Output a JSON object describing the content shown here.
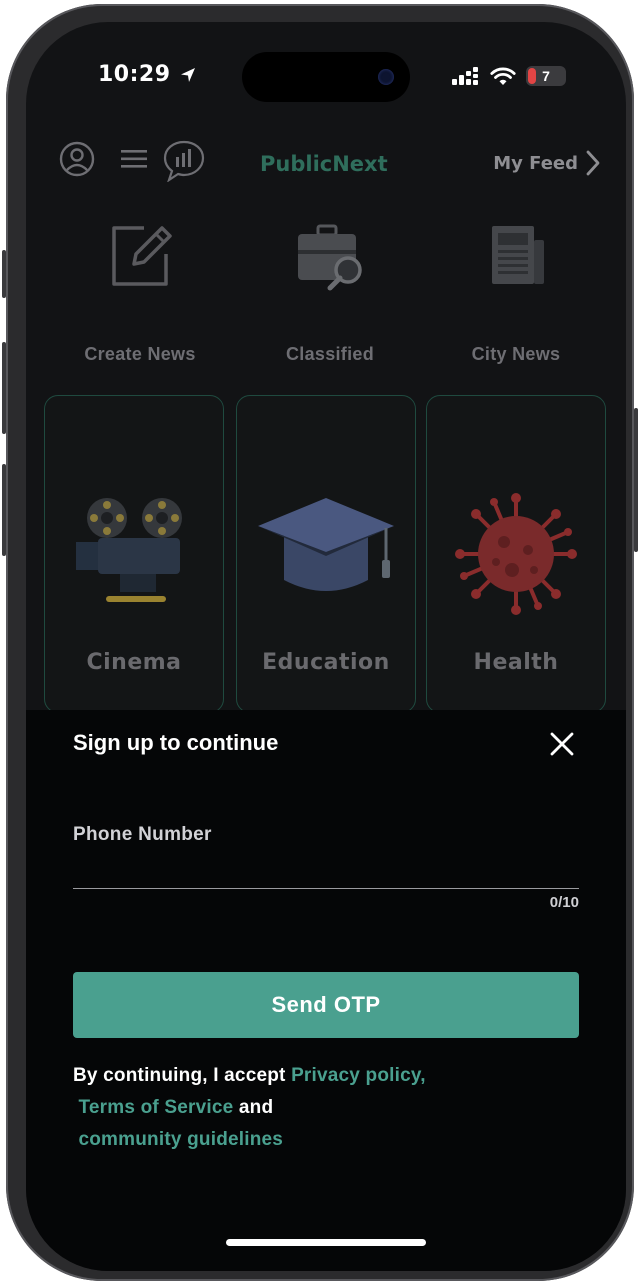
{
  "status_bar": {
    "time": "10:29",
    "battery": "7"
  },
  "header": {
    "brand": "PublicNext",
    "my_feed": "My Feed"
  },
  "quick_actions": [
    {
      "label": "Create News",
      "icon": "edit-icon"
    },
    {
      "label": "Classified",
      "icon": "briefcase-search-icon"
    },
    {
      "label": "City News",
      "icon": "newspaper-icon"
    }
  ],
  "categories": [
    {
      "label": "Cinema",
      "icon": "movie-camera-icon"
    },
    {
      "label": "Education",
      "icon": "graduation-cap-icon"
    },
    {
      "label": "Health",
      "icon": "virus-icon"
    }
  ],
  "signup_sheet": {
    "title": "Sign up to continue",
    "phone_label": "Phone Number",
    "counter": "0/10",
    "send_button": "Send OTP",
    "legal_prefix": "By continuing, I accept ",
    "privacy_link": "Privacy policy,",
    "terms_link": "Terms of Service",
    "and_text": " and",
    "community_link": "community guidelines"
  },
  "colors": {
    "accent": "#4aa08f",
    "brand_dim": "#2f6e5c",
    "background": "#121315"
  }
}
